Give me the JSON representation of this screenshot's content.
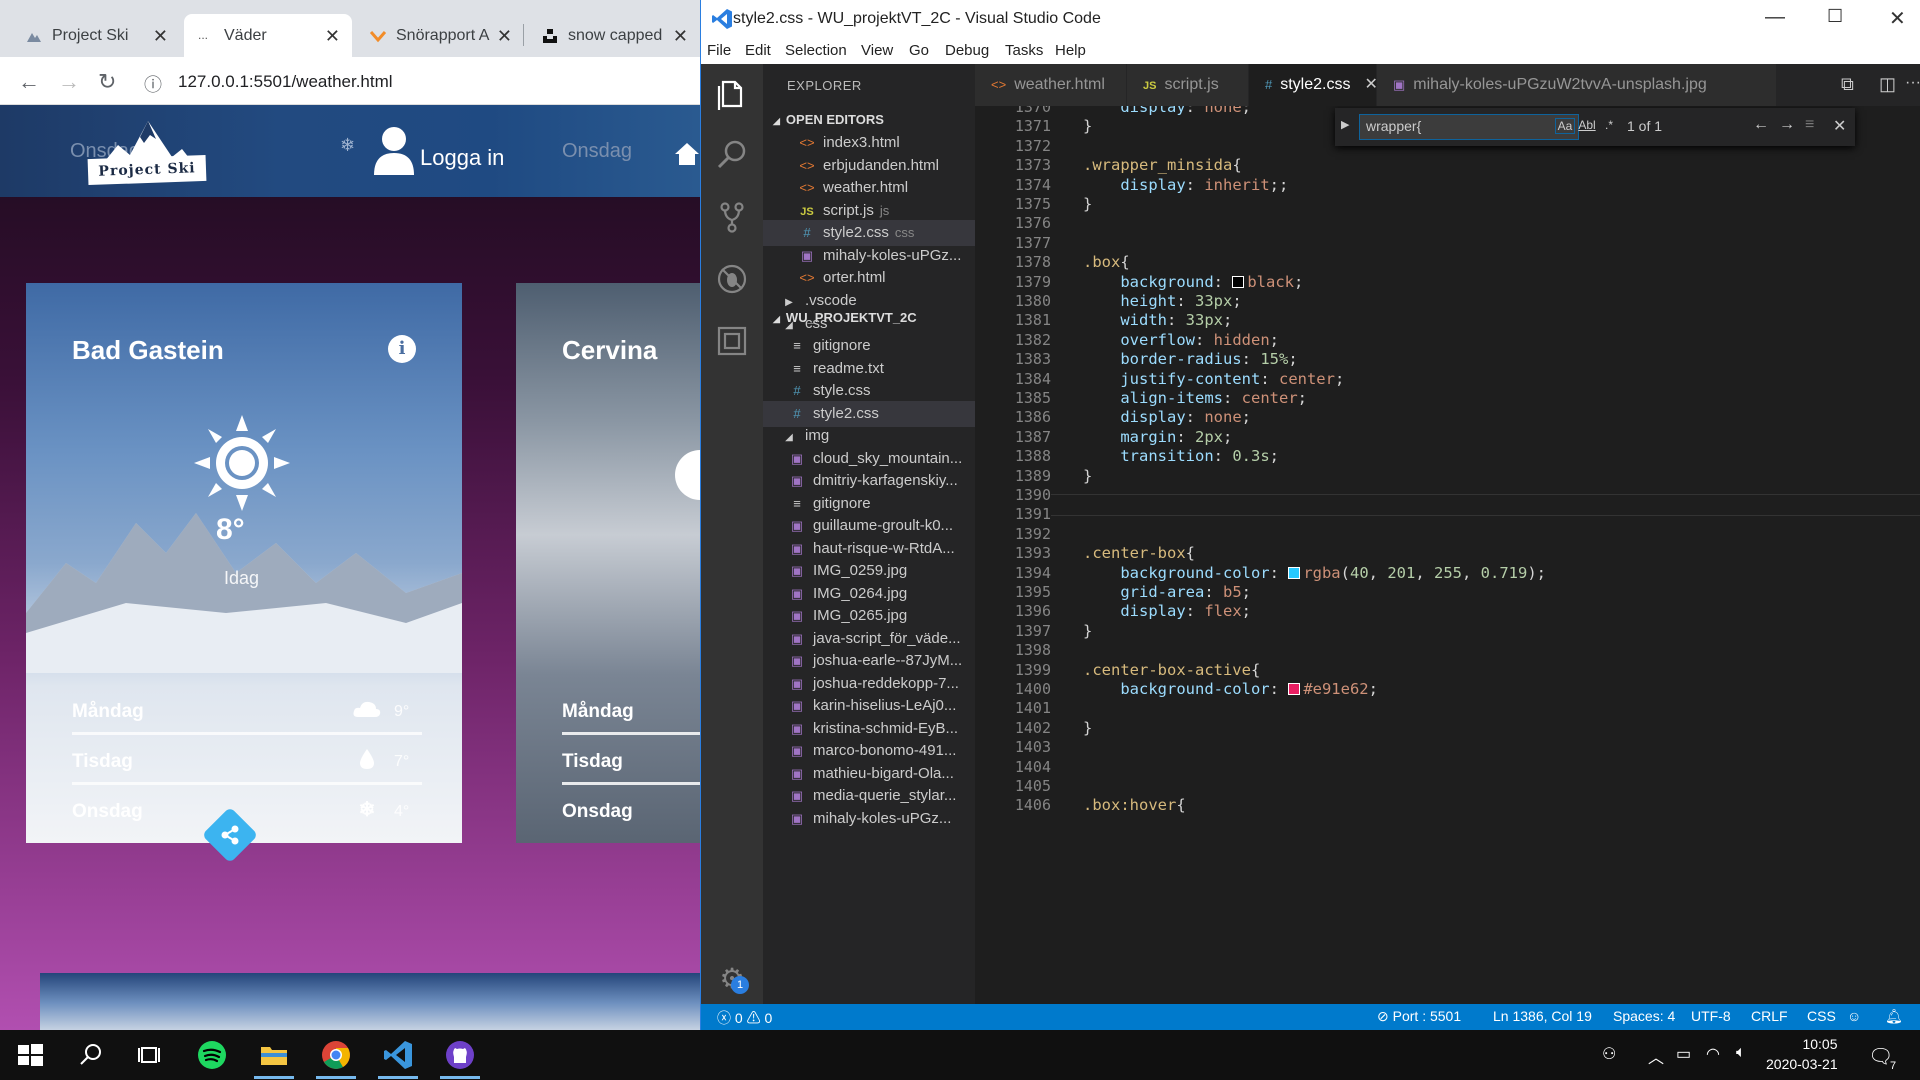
{
  "browser": {
    "tabs": [
      {
        "label": "Project Ski"
      },
      {
        "label": "Väder"
      },
      {
        "label": "Snörapport A"
      },
      {
        "label": "snow capped"
      }
    ],
    "url": "127.0.0.1:5501/weather.html",
    "site": {
      "header_days": [
        "Onsdag",
        "Onsdag"
      ],
      "logo_text": "Project Ski",
      "login": "Logga in",
      "card1": {
        "city": "Bad Gastein",
        "temp": "8°",
        "today": "Idag",
        "forecast": [
          {
            "day": "Måndag",
            "icon": "cloud-icon",
            "temp": "9°"
          },
          {
            "day": "Tisdag",
            "icon": "rain-icon",
            "temp": "7°"
          },
          {
            "day": "Onsdag",
            "icon": "snowflake-icon",
            "temp": "4°"
          }
        ]
      },
      "card2": {
        "city": "Cervina",
        "forecast": [
          {
            "day": "Måndag"
          },
          {
            "day": "Tisdag"
          },
          {
            "day": "Onsdag"
          }
        ]
      }
    }
  },
  "vscode": {
    "title": "style2.css - WU_projektVT_2C - Visual Studio Code",
    "menu": [
      "File",
      "Edit",
      "Selection",
      "View",
      "Go",
      "Debug",
      "Tasks",
      "Help"
    ],
    "explorer_title": "EXPLORER",
    "open_editors_label": "OPEN EDITORS",
    "open_editors": [
      {
        "name": "index3.html",
        "type": "html"
      },
      {
        "name": "erbjudanden.html",
        "type": "html"
      },
      {
        "name": "weather.html",
        "type": "html"
      },
      {
        "name": "script.js",
        "type": "js",
        "hint": "js"
      },
      {
        "name": "style2.css",
        "type": "css",
        "hint": "css"
      },
      {
        "name": "mihaly-koles-uPGz...",
        "type": "img"
      },
      {
        "name": "orter.html",
        "type": "html"
      }
    ],
    "project_label": "WU_PROJEKTVT_2C",
    "tree": [
      {
        "name": ".vscode",
        "type": "fold-closed",
        "indent": 1
      },
      {
        "name": "css",
        "type": "fold-open",
        "indent": 1
      },
      {
        "name": "gitignore",
        "type": "txt",
        "indent": 2
      },
      {
        "name": "readme.txt",
        "type": "txt",
        "indent": 2
      },
      {
        "name": "style.css",
        "type": "css",
        "indent": 2
      },
      {
        "name": "style2.css",
        "type": "css",
        "indent": 2
      },
      {
        "name": "img",
        "type": "fold-open",
        "indent": 1
      },
      {
        "name": "cloud_sky_mountain...",
        "type": "img",
        "indent": 2
      },
      {
        "name": "dmitriy-karfagenskiy...",
        "type": "img",
        "indent": 2
      },
      {
        "name": "gitignore",
        "type": "txt",
        "indent": 2
      },
      {
        "name": "guillaume-groult-k0...",
        "type": "img",
        "indent": 2
      },
      {
        "name": "haut-risque-w-RtdA...",
        "type": "img",
        "indent": 2
      },
      {
        "name": "IMG_0259.jpg",
        "type": "img",
        "indent": 2
      },
      {
        "name": "IMG_0264.jpg",
        "type": "img",
        "indent": 2
      },
      {
        "name": "IMG_0265.jpg",
        "type": "img",
        "indent": 2
      },
      {
        "name": "java-script_för_väde...",
        "type": "img",
        "indent": 2
      },
      {
        "name": "joshua-earle--87JyM...",
        "type": "img",
        "indent": 2
      },
      {
        "name": "joshua-reddekopp-7...",
        "type": "img",
        "indent": 2
      },
      {
        "name": "karin-hiselius-LeAj0...",
        "type": "img",
        "indent": 2
      },
      {
        "name": "kristina-schmid-EyB...",
        "type": "img",
        "indent": 2
      },
      {
        "name": "marco-bonomo-491...",
        "type": "img",
        "indent": 2
      },
      {
        "name": "mathieu-bigard-Ola...",
        "type": "img",
        "indent": 2
      },
      {
        "name": "media-querie_stylar...",
        "type": "img",
        "indent": 2
      },
      {
        "name": "mihaly-koles-uPGz...",
        "type": "img",
        "indent": 2
      }
    ],
    "editor_tabs": [
      {
        "label": "weather.html",
        "icon": "<>"
      },
      {
        "label": "script.js",
        "icon": "JS"
      },
      {
        "label": "style2.css",
        "icon": "#"
      },
      {
        "label": "mihaly-koles-uPGzuW2tvvA-unsplash.jpg",
        "icon": "▣"
      }
    ],
    "find": {
      "query": "wrapper{",
      "count": "1 of 1",
      "opt_case": "Aa",
      "opt_word": "Abl",
      "opt_regex": ".*"
    },
    "code_lines": [
      {
        "n": "1370",
        "t": "    display: none;"
      },
      {
        "n": "1371",
        "t": "}"
      },
      {
        "n": "1372",
        "t": ""
      },
      {
        "n": "1373",
        "t": ".wrapper_minsida{"
      },
      {
        "n": "1374",
        "t": "    display: inherit;;"
      },
      {
        "n": "1375",
        "t": "}"
      },
      {
        "n": "1376",
        "t": ""
      },
      {
        "n": "1377",
        "t": ""
      },
      {
        "n": "1378",
        "t": ".box{"
      },
      {
        "n": "1379",
        "t": "    background: black;"
      },
      {
        "n": "1380",
        "t": "    height: 33px;"
      },
      {
        "n": "1381",
        "t": "    width: 33px;"
      },
      {
        "n": "1382",
        "t": "    overflow: hidden;"
      },
      {
        "n": "1383",
        "t": "    border-radius: 15%;"
      },
      {
        "n": "1384",
        "t": "    justify-content: center;"
      },
      {
        "n": "1385",
        "t": "    align-items: center;"
      },
      {
        "n": "1386",
        "t": "    display: none;"
      },
      {
        "n": "1387",
        "t": "    margin: 2px;"
      },
      {
        "n": "1388",
        "t": "    transition: 0.3s;"
      },
      {
        "n": "1389",
        "t": "}"
      },
      {
        "n": "1390",
        "t": ""
      },
      {
        "n": "1391",
        "t": ""
      },
      {
        "n": "1392",
        "t": ""
      },
      {
        "n": "1393",
        "t": ".center-box{"
      },
      {
        "n": "1394",
        "t": "    background-color: rgba(40, 201, 255, 0.719);"
      },
      {
        "n": "1395",
        "t": "    grid-area: b5;"
      },
      {
        "n": "1396",
        "t": "    display: flex;"
      },
      {
        "n": "1397",
        "t": "}"
      },
      {
        "n": "1398",
        "t": ""
      },
      {
        "n": "1399",
        "t": ".center-box-active{"
      },
      {
        "n": "1400",
        "t": "    background-color: #e91e62;"
      },
      {
        "n": "1401",
        "t": ""
      },
      {
        "n": "1402",
        "t": "}"
      },
      {
        "n": "1403",
        "t": ""
      },
      {
        "n": "1404",
        "t": ""
      },
      {
        "n": "1405",
        "t": ""
      },
      {
        "n": "1406",
        "t": ".box:hover{"
      }
    ],
    "status": {
      "errors": "0",
      "warnings": "0",
      "port": "Port : 5501",
      "position": "Ln 1386, Col 19",
      "spaces": "Spaces: 4",
      "encoding": "UTF-8",
      "eol": "CRLF",
      "language": "CSS"
    },
    "gear_badge": "1"
  },
  "taskbar": {
    "time": "10:05",
    "date": "2020-03-21",
    "notifications": "7"
  },
  "colors": {
    "accent": "#007acc",
    "swatch_cyan": "#28c9ff",
    "swatch_pink": "#e91e62",
    "swatch_black": "#000000"
  }
}
